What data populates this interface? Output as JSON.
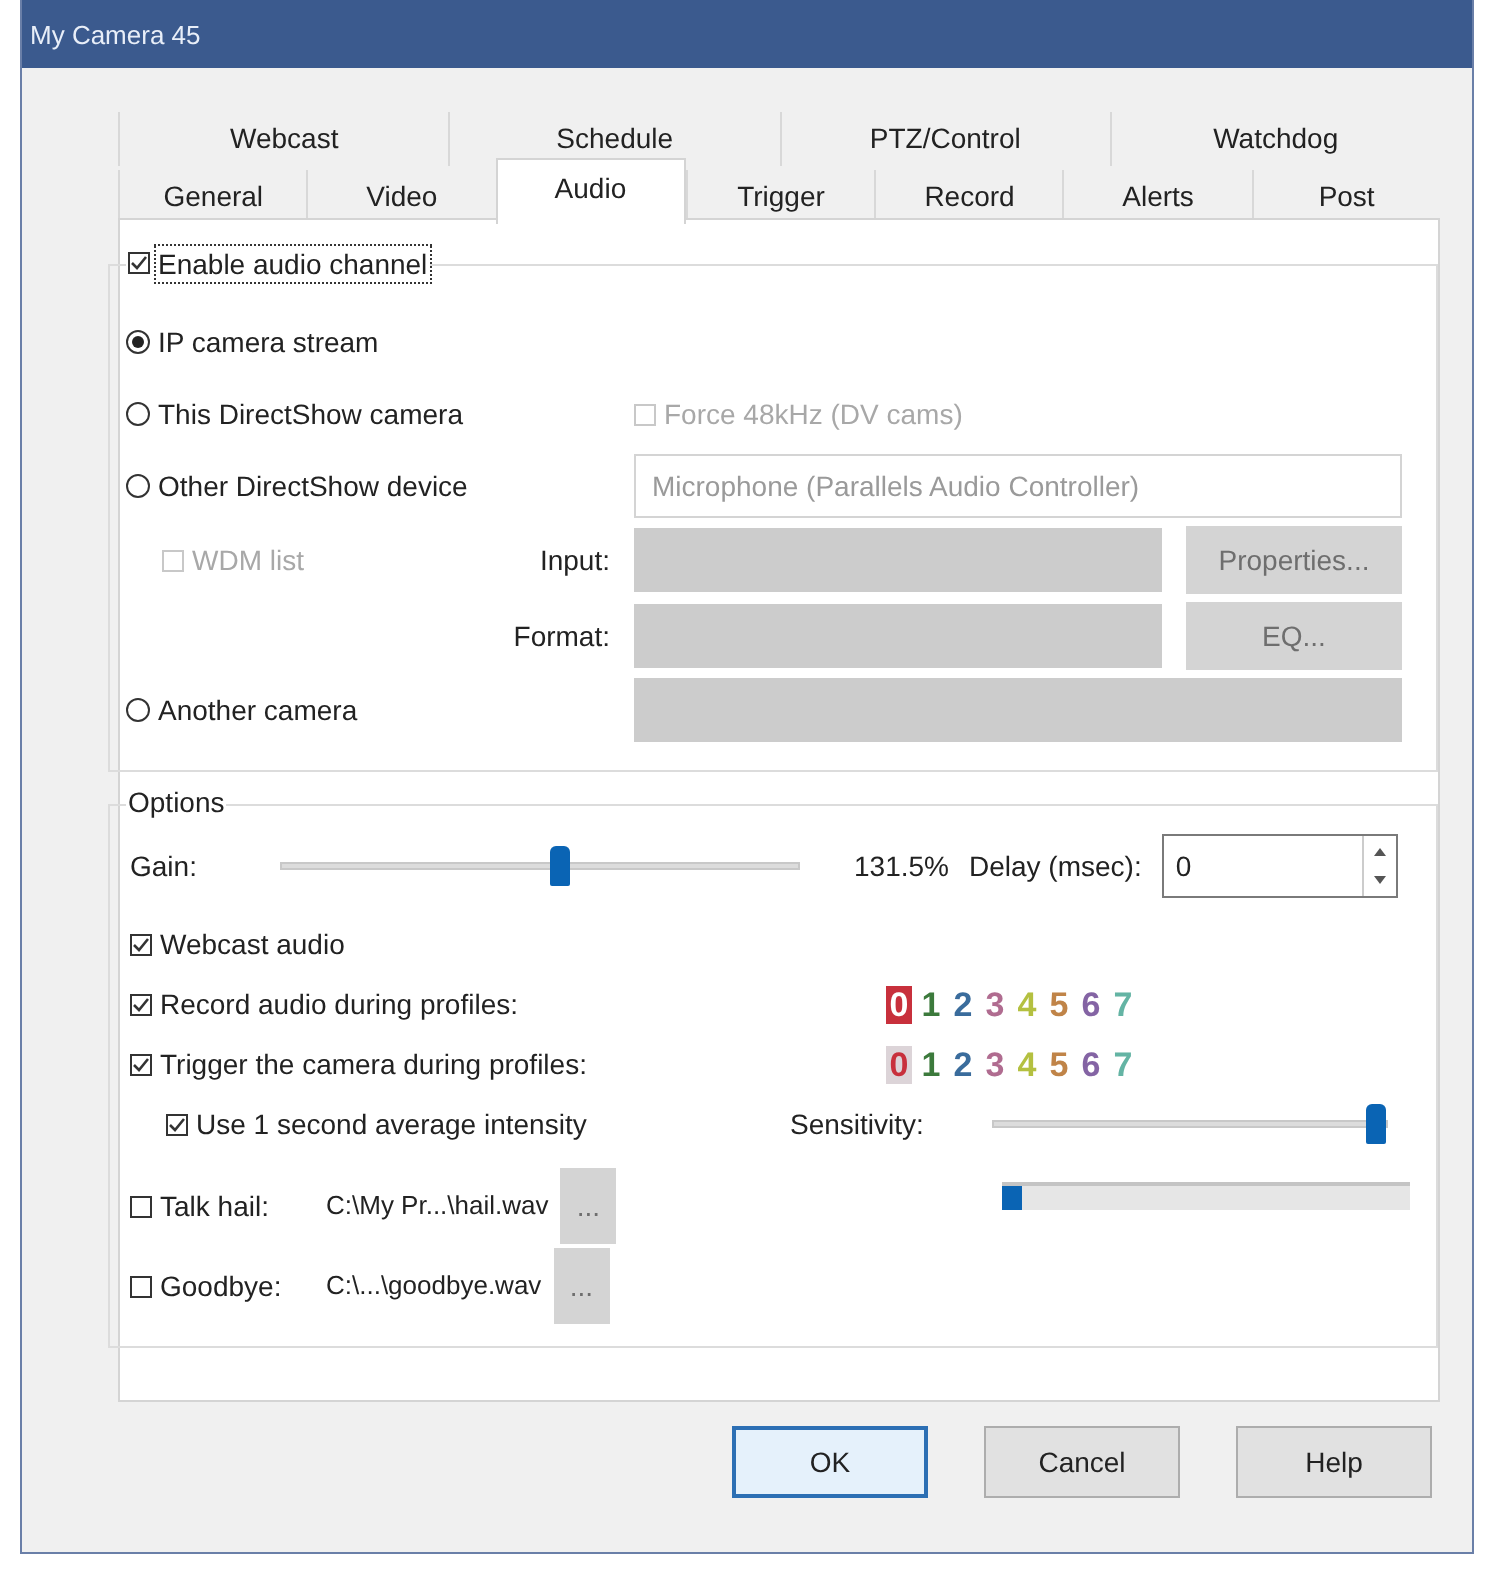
{
  "window": {
    "title": "My Camera 45"
  },
  "tabs": {
    "back_row": [
      {
        "label": "Webcast",
        "selected": false
      },
      {
        "label": "Schedule",
        "selected": false
      },
      {
        "label": "PTZ/Control",
        "selected": false
      },
      {
        "label": "Watchdog",
        "selected": false
      }
    ],
    "front_row": [
      {
        "label": "General",
        "selected": false
      },
      {
        "label": "Video",
        "selected": false
      },
      {
        "label": "Audio",
        "selected": true
      },
      {
        "label": "Trigger",
        "selected": false
      },
      {
        "label": "Record",
        "selected": false
      },
      {
        "label": "Alerts",
        "selected": false
      },
      {
        "label": "Post",
        "selected": false
      }
    ]
  },
  "source": {
    "enable": {
      "label": "Enable audio channel",
      "checked": true
    },
    "radios": [
      {
        "label": "IP camera stream",
        "selected": true
      },
      {
        "label": "This DirectShow camera",
        "selected": false
      },
      {
        "label": "Other DirectShow device",
        "selected": false
      },
      {
        "label": "Another camera",
        "selected": false
      }
    ],
    "force48": {
      "label": "Force 48kHz (DV cams)",
      "checked": false,
      "disabled": true
    },
    "device": {
      "value": "Microphone (Parallels Audio Controller)",
      "disabled": true
    },
    "wdm": {
      "label": "WDM list",
      "checked": false,
      "disabled": true
    },
    "input": {
      "label": "Input:",
      "disabled": true
    },
    "format": {
      "label": "Format:",
      "disabled": true
    },
    "properties_button": {
      "label": "Properties...",
      "disabled": true
    },
    "eq_button": {
      "label": "EQ...",
      "disabled": true
    },
    "camera": {
      "disabled": true
    }
  },
  "options": {
    "title": "Options",
    "gain": {
      "label": "Gain:",
      "level": 0.54,
      "reading": "131.5%"
    },
    "delay": {
      "label": "Delay (msec):",
      "value": "0"
    },
    "webcast": {
      "label": "Webcast audio",
      "checked": true
    },
    "record": {
      "label": "Record audio during profiles:",
      "checked": true,
      "profiles": [
        {
          "label": "0",
          "color": "#c8303c",
          "selected": true,
          "disabled": false
        },
        {
          "label": "1",
          "color": "#3c7a3c",
          "selected": false,
          "disabled": false
        },
        {
          "label": "2",
          "color": "#3a6c9c",
          "selected": false,
          "disabled": false
        },
        {
          "label": "3",
          "color": "#b06c90",
          "selected": false,
          "disabled": false
        },
        {
          "label": "4",
          "color": "#b4c040",
          "selected": false,
          "disabled": false
        },
        {
          "label": "5",
          "color": "#c08448",
          "selected": false,
          "disabled": false
        },
        {
          "label": "6",
          "color": "#8464a4",
          "selected": false,
          "disabled": false
        },
        {
          "label": "7",
          "color": "#64b4a4",
          "selected": false,
          "disabled": false
        }
      ]
    },
    "trigger": {
      "label": "Trigger the camera during profiles:",
      "checked": true,
      "profiles": [
        {
          "label": "0",
          "color": "#c8303c",
          "selected": false,
          "disabled": true
        },
        {
          "label": "1",
          "color": "#3c7a3c",
          "selected": false,
          "disabled": false
        },
        {
          "label": "2",
          "color": "#3a6c9c",
          "selected": false,
          "disabled": false
        },
        {
          "label": "3",
          "color": "#b06c90",
          "selected": false,
          "disabled": false
        },
        {
          "label": "4",
          "color": "#b4c040",
          "selected": false,
          "disabled": false
        },
        {
          "label": "5",
          "color": "#c08448",
          "selected": false,
          "disabled": false
        },
        {
          "label": "6",
          "color": "#8464a4",
          "selected": false,
          "disabled": false
        },
        {
          "label": "7",
          "color": "#64b4a4",
          "selected": false,
          "disabled": false
        }
      ]
    },
    "average": {
      "label": "Use 1 second average intensity",
      "checked": true
    },
    "sensitivity": {
      "label": "Sensitivity:",
      "level": 0.97
    },
    "meter": {
      "level": 0.05
    },
    "sounds": [
      {
        "label": "Talk hail:",
        "checked": false,
        "path": "C:\\My Pr...\\hail.wav",
        "button": "..."
      },
      {
        "label": "Goodbye:",
        "checked": false,
        "path": "C:\\...\\goodbye.wav",
        "button": "..."
      }
    ]
  },
  "buttons": [
    {
      "label": "OK",
      "kind": "default"
    },
    {
      "label": "Cancel",
      "kind": "normal"
    },
    {
      "label": "Help",
      "kind": "normal"
    }
  ]
}
